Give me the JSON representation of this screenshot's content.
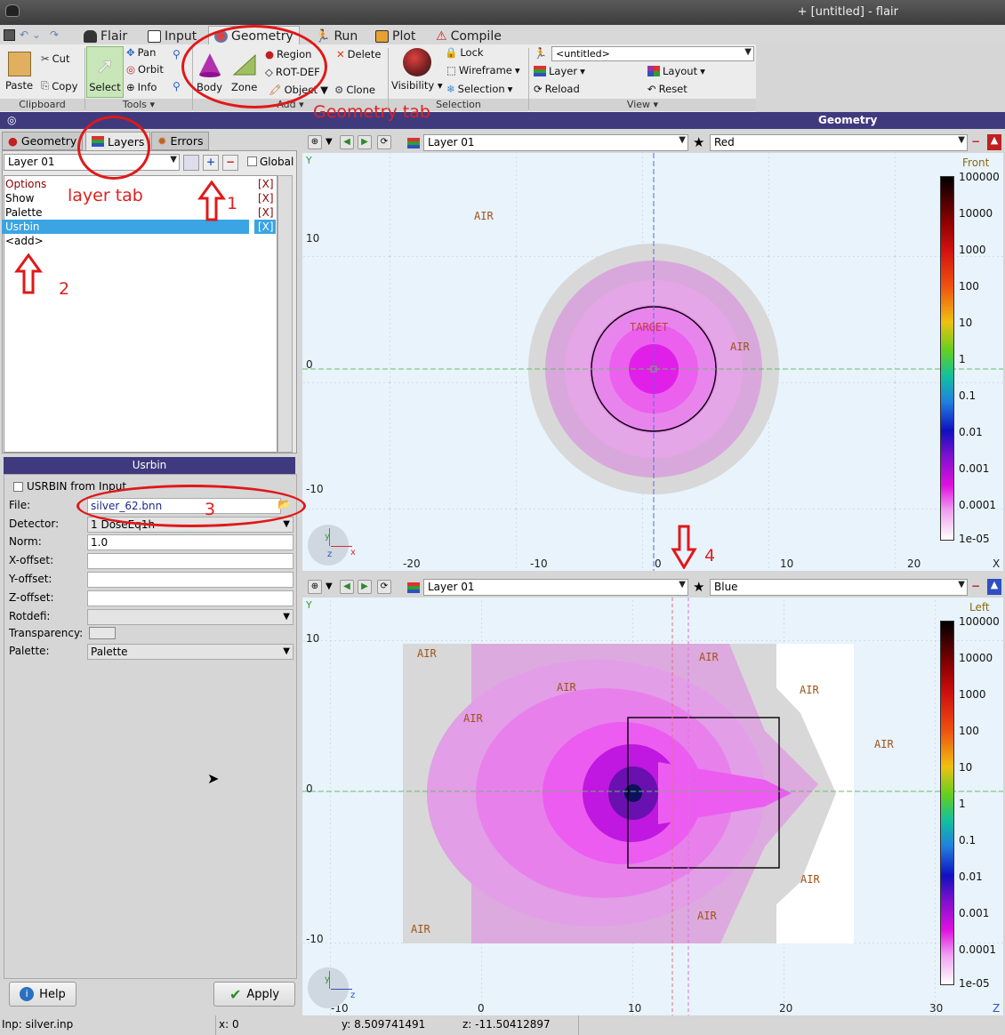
{
  "window": {
    "title": "+ [untitled] - flair"
  },
  "menu": {
    "tabs": [
      {
        "label": "Flair"
      },
      {
        "label": "Input"
      },
      {
        "label": "Geometry"
      },
      {
        "label": "Run"
      },
      {
        "label": "Plot"
      },
      {
        "label": "Compile"
      }
    ]
  },
  "ribbon": {
    "clipboard": {
      "paste": "Paste",
      "cut": "Cut",
      "copy": "Copy",
      "group": "Clipboard"
    },
    "tools": {
      "select": "Select",
      "pan": "Pan",
      "orbit": "Orbit",
      "info": "Info",
      "group": "Tools"
    },
    "add": {
      "body": "Body",
      "zone": "Zone",
      "region": "Region",
      "rotdef": "ROT-DEF",
      "object": "Object",
      "delete": "Delete",
      "clone": "Clone",
      "group": "Add"
    },
    "selection": {
      "lock": "Lock",
      "wireframe": "Wireframe",
      "visibility": "Visibility",
      "selection": "Selection",
      "group": "Selection"
    },
    "view": {
      "project": "<untitled>",
      "layer": "Layer",
      "layout": "Layout",
      "reload": "Reload",
      "reset": "Reset",
      "group": "View"
    }
  },
  "geometry_bar": {
    "title": "Geometry"
  },
  "left": {
    "tabs": [
      {
        "label": "Geometry"
      },
      {
        "label": "Layers"
      },
      {
        "label": "Errors"
      }
    ],
    "layer_combo": "Layer 01",
    "global_label": "Global",
    "layer_items": [
      {
        "label": "Options",
        "flag": "[X]"
      },
      {
        "label": "Show",
        "flag": "[X]"
      },
      {
        "label": "Palette",
        "flag": "[X]"
      },
      {
        "label": "Usrbin",
        "flag": "[X]"
      },
      {
        "label": "<add>",
        "flag": ""
      }
    ],
    "usrbin": {
      "title": "Usrbin",
      "from_input": "USRBIN from Input",
      "fields": [
        {
          "label": "File:",
          "value": "silver_62.bnn"
        },
        {
          "label": "Detector:",
          "value": "1 DoseEq1h"
        },
        {
          "label": "Norm:",
          "value": "1.0"
        },
        {
          "label": "X-offset:",
          "value": ""
        },
        {
          "label": "Y-offset:",
          "value": ""
        },
        {
          "label": "Z-offset:",
          "value": ""
        },
        {
          "label": "Rotdefi:",
          "value": ""
        },
        {
          "label": "Transparency:",
          "value": ""
        },
        {
          "label": "Palette:",
          "value": "Palette"
        }
      ]
    },
    "help": "Help",
    "apply": "Apply"
  },
  "annotations": {
    "geometry_tab": "Geometry tab",
    "layer_tab": "layer tab",
    "n1": "1",
    "n2": "2",
    "n3": "3",
    "n4": "4"
  },
  "colorbar": {
    "labels": [
      "100000",
      "10000",
      "1000",
      "100",
      "10",
      "1",
      "0.1",
      "0.01",
      "0.001",
      "0.0001",
      "1e-05"
    ]
  },
  "view_top": {
    "layer": "Layer 01",
    "color": "Red",
    "orientation": "Front",
    "axis_y": "Y",
    "axis_x": "X",
    "xticks": [
      "-20",
      "-10",
      "0",
      "10",
      "20"
    ],
    "yticks": [
      "10",
      "0",
      "-10"
    ],
    "labels": {
      "air1": "AIR",
      "air2": "AIR",
      "target": "TARGET"
    }
  },
  "view_bottom": {
    "layer": "Layer 01",
    "color": "Blue",
    "orientation": "Left",
    "axis_y": "Y",
    "axis_z": "Z",
    "xticks": [
      "-10",
      "0",
      "10",
      "20",
      "30"
    ],
    "yticks": [
      "10",
      "0",
      "-10"
    ],
    "air_labels": [
      "AIR",
      "AIR",
      "AIR",
      "AIR",
      "AIR",
      "AIR",
      "AIR",
      "AIR"
    ]
  },
  "status": {
    "input": "Inp: silver.inp",
    "x": "x: 0",
    "y": "y: 8.509741491",
    "z": "z: -11.50412897"
  }
}
